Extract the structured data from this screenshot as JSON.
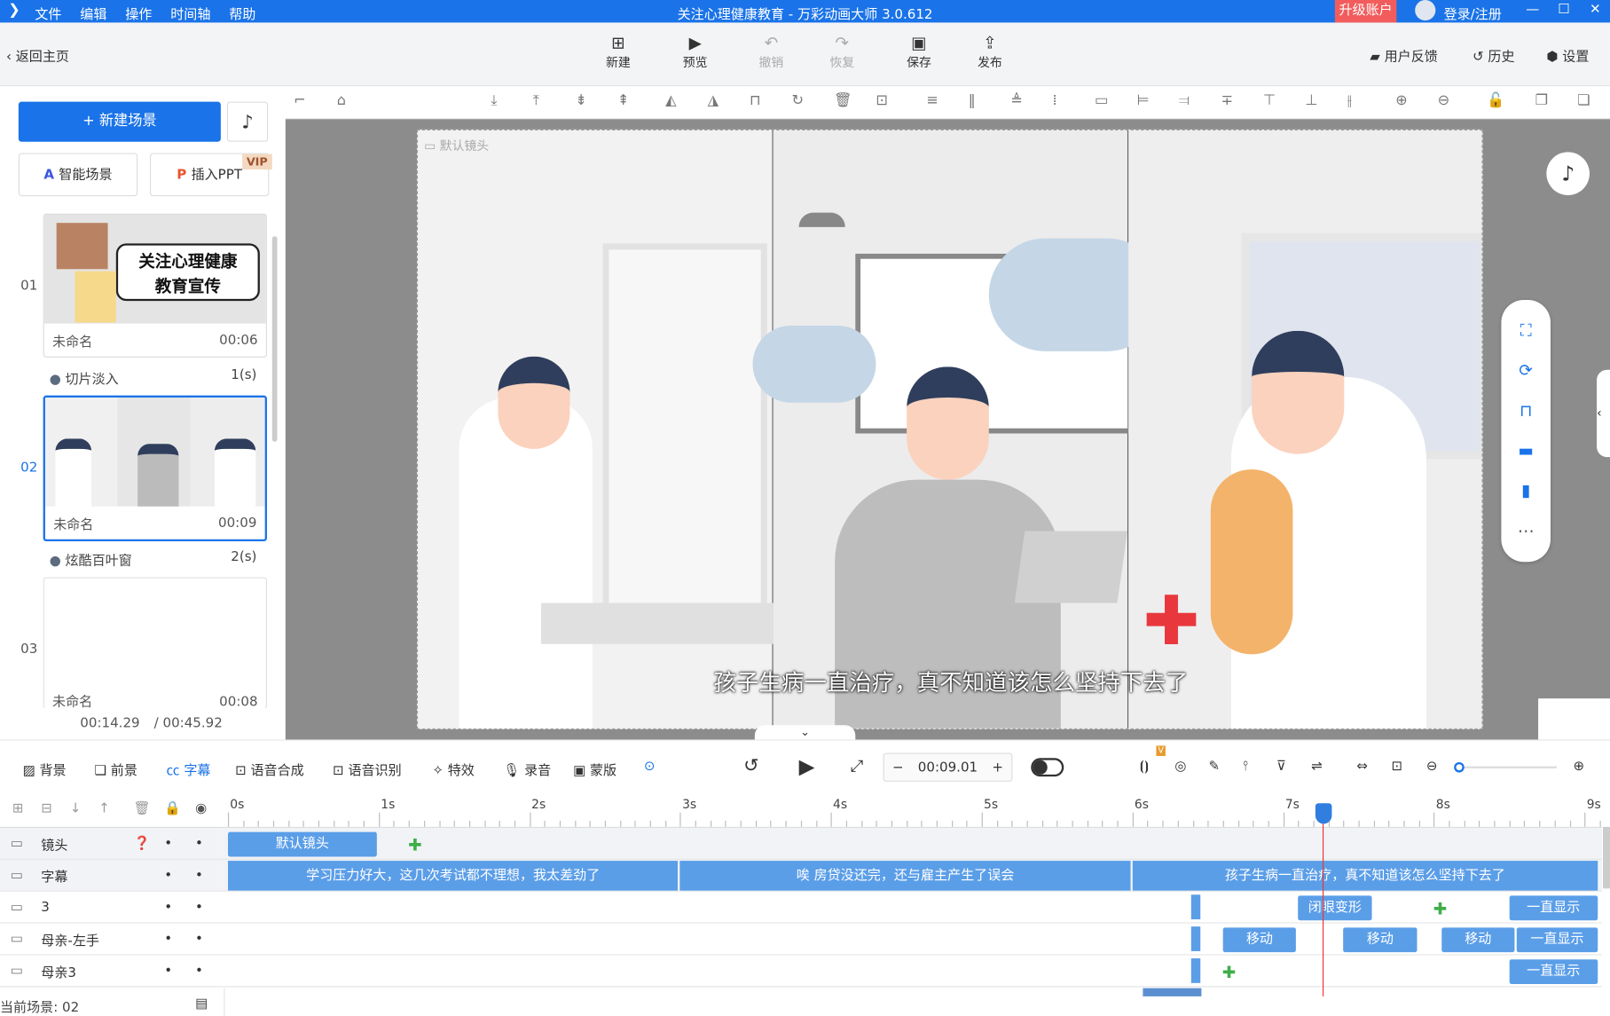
{
  "window": {
    "title": "关注心理健康教育 - 万彩动画大师 3.0.612",
    "menu": [
      "文件",
      "编辑",
      "操作",
      "时间轴",
      "帮助"
    ],
    "upgrade": "升级账户",
    "login": "登录/注册",
    "controls": [
      "—",
      "☐",
      "✕"
    ]
  },
  "toolbar": {
    "back": "返回主页",
    "buttons": [
      {
        "label": "新建",
        "icon": "plus-square-icon",
        "enabled": true
      },
      {
        "label": "预览",
        "icon": "play-icon",
        "enabled": true
      },
      {
        "label": "撤销",
        "icon": "undo-icon",
        "enabled": false
      },
      {
        "label": "恢复",
        "icon": "redo-icon",
        "enabled": false
      },
      {
        "label": "保存",
        "icon": "save-icon",
        "enabled": true
      },
      {
        "label": "发布",
        "icon": "publish-icon",
        "enabled": true
      }
    ],
    "feedback": "用户反馈",
    "history": "历史",
    "settings": "设置"
  },
  "left": {
    "new_scene": "新建场景",
    "smart_scene": "智能场景",
    "insert_ppt": "插入PPT",
    "vip": "VIP",
    "scenes": [
      {
        "num": "01",
        "name": "未命名",
        "duration": "00:06",
        "thumb_text": [
          "关注心理健康",
          "教育宣传"
        ],
        "selected": false
      },
      {
        "num": "02",
        "name": "未命名",
        "duration": "00:09",
        "selected": true
      },
      {
        "num": "03",
        "name": "未命名",
        "duration": "00:08",
        "selected": false
      }
    ],
    "transitions": [
      {
        "name": "切片淡入",
        "duration": "1(s)"
      },
      {
        "name": "炫酷百叶窗",
        "duration": "2(s)"
      }
    ],
    "current_time": "00:14.29",
    "total_time": "/ 00:45.92"
  },
  "canvas": {
    "camera_label": "默认镜头",
    "subtitle": "孩子生病一直治疗，真不知道该怎么坚持下去了"
  },
  "timeline": {
    "tools": [
      "背景",
      "前景",
      "字幕",
      "语音合成",
      "语音识别",
      "特效",
      "录音",
      "蒙版"
    ],
    "active_tool": "字幕",
    "time": "00:09.01",
    "minus": "−",
    "plus": "+",
    "ticks": [
      "0s",
      "1s",
      "2s",
      "3s",
      "4s",
      "5s",
      "6s",
      "7s",
      "8s",
      "9s"
    ],
    "playhead_s": 7.26,
    "tracks": [
      {
        "name": "镜头",
        "blocks": [
          {
            "label": "默认镜头",
            "start": 0,
            "end": 1
          }
        ],
        "keyframes": [
          1.25
        ]
      },
      {
        "name": "字幕",
        "blocks": [
          {
            "label": "学习压力好大，这几次考试都不理想，我太差劲了",
            "start": 0,
            "end": 3
          },
          {
            "label": "唉 房贷没还完，还与雇主产生了误会",
            "start": 3,
            "end": 6
          },
          {
            "label": "孩子生病一直治疗，真不知道该怎么坚持下去了",
            "start": 6,
            "end": 9.1
          }
        ]
      },
      {
        "name": "3",
        "blocks": [
          {
            "label": "闭眼变形",
            "start": 7.1,
            "end": 7.6
          },
          {
            "label": "一直显示",
            "start": 8.5,
            "end": 9.1
          }
        ],
        "keyframes": [
          8.05
        ]
      },
      {
        "name": "母亲-左手",
        "blocks": [
          {
            "label": "移动",
            "start": 6.6,
            "end": 7.1
          },
          {
            "label": "移动",
            "start": 7.4,
            "end": 7.9
          },
          {
            "label": "移动",
            "start": 8.05,
            "end": 8.55
          },
          {
            "label": "一直显示",
            "start": 8.55,
            "end": 9.1
          }
        ]
      },
      {
        "name": "母亲3",
        "blocks": [
          {
            "label": "一直显示",
            "start": 8.5,
            "end": 9.1
          }
        ],
        "keyframes": [
          6.65
        ]
      }
    ],
    "current_scene": "当前场景: 02"
  }
}
